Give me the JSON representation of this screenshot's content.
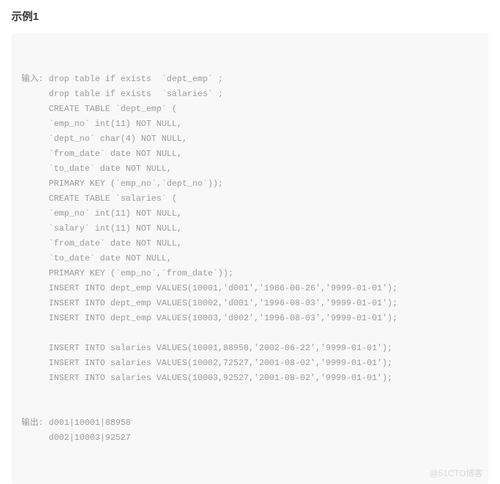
{
  "title": "示例1",
  "input_label": "输入:",
  "output_label": "输出:",
  "input_lines": [
    "drop table if exists  `dept_emp` ;",
    "drop table if exists  `salaries` ;",
    "CREATE TABLE `dept_emp` (",
    "`emp_no` int(11) NOT NULL,",
    "`dept_no` char(4) NOT NULL,",
    "`from_date` date NOT NULL,",
    "`to_date` date NOT NULL,",
    "PRIMARY KEY (`emp_no`,`dept_no`));",
    "CREATE TABLE `salaries` (",
    "`emp_no` int(11) NOT NULL,",
    "`salary` int(11) NOT NULL,",
    "`from_date` date NOT NULL,",
    "`to_date` date NOT NULL,",
    "PRIMARY KEY (`emp_no`,`from_date`));",
    "INSERT INTO dept_emp VALUES(10001,'d001','1986-06-26','9999-01-01');",
    "INSERT INTO dept_emp VALUES(10002,'d001','1996-08-03','9999-01-01');",
    "INSERT INTO dept_emp VALUES(10003,'d002','1996-08-03','9999-01-01');",
    "",
    "INSERT INTO salaries VALUES(10001,88958,'2002-06-22','9999-01-01');",
    "INSERT INTO salaries VALUES(10002,72527,'2001-08-02','9999-01-01');",
    "INSERT INTO salaries VALUES(10003,92527,'2001-08-02','9999-01-01');"
  ],
  "output_lines": [
    "d001|10001|88958",
    "d002|10003|92527"
  ],
  "watermark": "@51CTO博客"
}
